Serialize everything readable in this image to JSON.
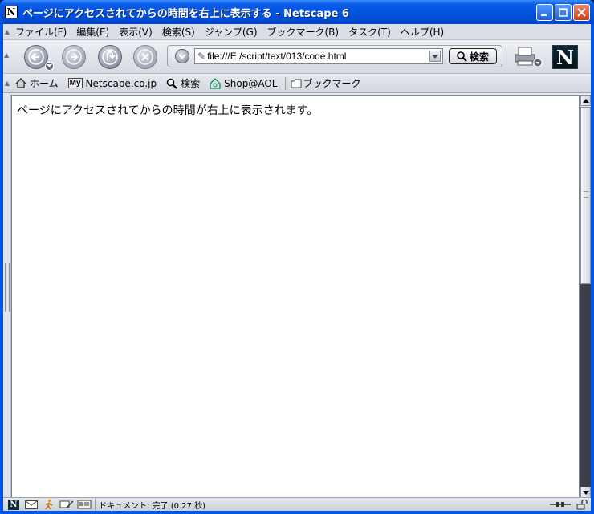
{
  "window": {
    "title": "ページにアクセスされてからの時間を右上に表示する - Netscape 6",
    "icon_letter": "N"
  },
  "menu": {
    "items": [
      "ファイル(F)",
      "編集(E)",
      "表示(V)",
      "検索(S)",
      "ジャンプ(G)",
      "ブックマーク(B)",
      "タスク(T)",
      "ヘルプ(H)"
    ]
  },
  "nav": {
    "url": "file:///E:/script/text/013/code.html",
    "search_label": "検索",
    "logo_letter": "N"
  },
  "personal_toolbar": {
    "home": "ホーム",
    "my_badge": "My",
    "netscape": "Netscape.co.jp",
    "search": "検索",
    "shop": "Shop@AOL",
    "bookmarks": "ブックマーク"
  },
  "content": {
    "text": "ページにアクセスされてからの時間が右上に表示されます。"
  },
  "status": {
    "text": "ドキュメント: 完了 (0.27 秒)",
    "n_letter": "N"
  }
}
